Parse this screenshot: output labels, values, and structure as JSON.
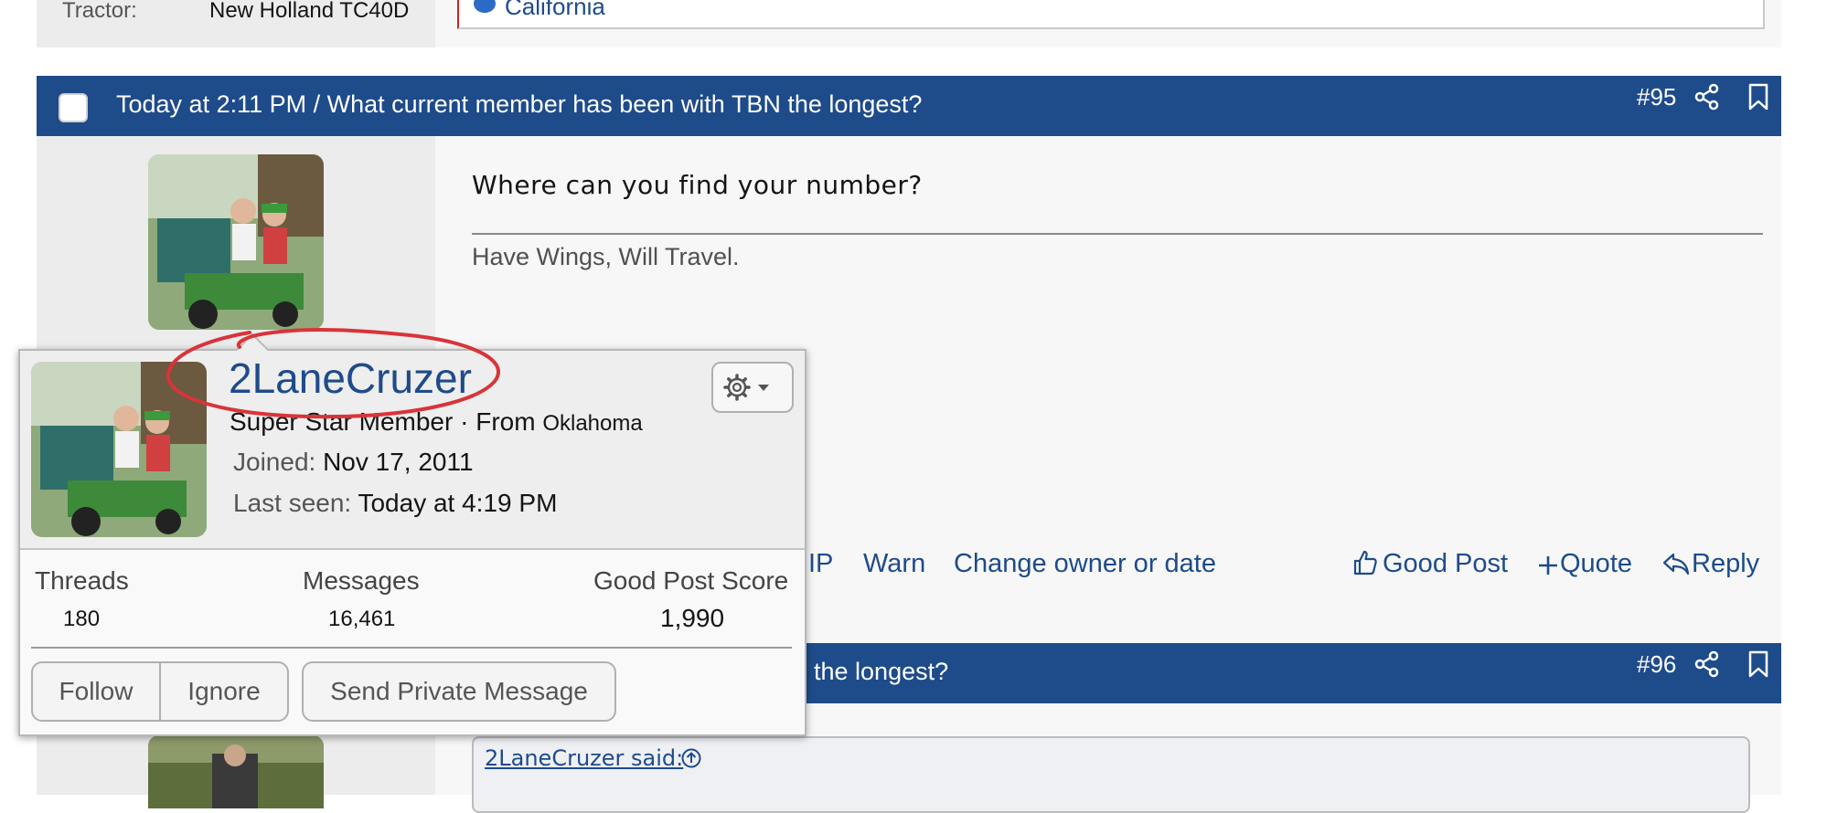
{
  "prev_post": {
    "tractor_label": "Tractor:",
    "tractor_value": "New Holland TC40D",
    "location": "California"
  },
  "post95": {
    "header_title": "Today at 2:11 PM / What current member has been with TBN the longest?",
    "number": "#95",
    "content": "Where can you find your number?",
    "signature": "Have Wings, Will Travel.",
    "actions": {
      "ip": "IP",
      "warn": "Warn",
      "change_owner": "Change owner or date",
      "good_post": "Good Post",
      "quote": "Quote",
      "reply": "Reply"
    }
  },
  "post96": {
    "header_title": "the longest?",
    "number": "#96",
    "quote_author": "2LaneCruzer said:"
  },
  "member_card": {
    "username": "2LaneCruzer",
    "title": "Super Star Member",
    "from_prefix": " · From ",
    "location": "Oklahoma",
    "joined_label": "Joined:",
    "joined_value": "Nov 17, 2011",
    "last_seen_label": "Last seen:",
    "last_seen_value": "Today at 4:19 PM",
    "stats": {
      "threads_label": "Threads",
      "threads_value": "180",
      "messages_label": "Messages",
      "messages_value": "16,461",
      "good_post_score_label": "Good Post Score",
      "good_post_score_value": "1,990"
    },
    "buttons": {
      "follow": "Follow",
      "ignore": "Ignore",
      "send_pm": "Send Private Message"
    }
  },
  "colors": {
    "header_blue": "#1e4b8a",
    "link_blue": "#1e4b8a",
    "annotation_red": "#d8343a"
  }
}
